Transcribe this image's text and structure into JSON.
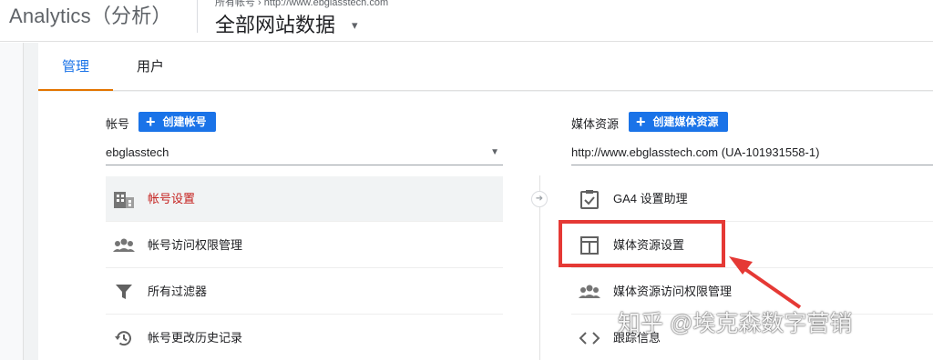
{
  "header": {
    "app_title": "Analytics（分析）",
    "breadcrumb": "所有帐号 › http://www.ebglasstech.com",
    "scope_title": "全部网站数据",
    "scope_caret": "▾"
  },
  "tabs": [
    {
      "label": "管理",
      "active": true
    },
    {
      "label": "用户",
      "active": false
    }
  ],
  "account": {
    "label": "帐号",
    "create_button": "创建帐号",
    "selected": "ebglasstech",
    "items": [
      {
        "label": "帐号设置",
        "icon": "building-icon",
        "active": true
      },
      {
        "label": "帐号访问权限管理",
        "icon": "people-icon",
        "active": false
      },
      {
        "label": "所有过滤器",
        "icon": "filter-icon",
        "active": false
      },
      {
        "label": "帐号更改历史记录",
        "icon": "history-icon",
        "active": false
      }
    ]
  },
  "property": {
    "label": "媒体资源",
    "create_button": "创建媒体资源",
    "selected": "http://www.ebglasstech.com (UA-101931558-1)",
    "items": [
      {
        "label": "GA4 设置助理",
        "icon": "checklist-icon"
      },
      {
        "label": "媒体资源设置",
        "icon": "layout-icon"
      },
      {
        "label": "媒体资源访问权限管理",
        "icon": "people-icon"
      },
      {
        "label": "跟踪信息",
        "icon": "code-icon"
      }
    ]
  },
  "watermark": "知乎 @埃克森数字营销",
  "colors": {
    "accent": "#1a73e8",
    "tab_underline": "#e37400",
    "active_item_text": "#c5221f",
    "annotation_red": "#e53935"
  }
}
